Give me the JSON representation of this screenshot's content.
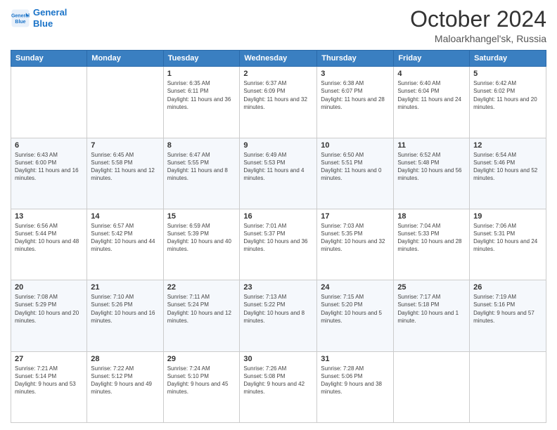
{
  "logo": {
    "line1": "General",
    "line2": "Blue"
  },
  "header": {
    "month": "October 2024",
    "location": "Maloarkhangel'sk, Russia"
  },
  "days_of_week": [
    "Sunday",
    "Monday",
    "Tuesday",
    "Wednesday",
    "Thursday",
    "Friday",
    "Saturday"
  ],
  "weeks": [
    [
      {
        "day": "",
        "sunrise": "",
        "sunset": "",
        "daylight": ""
      },
      {
        "day": "",
        "sunrise": "",
        "sunset": "",
        "daylight": ""
      },
      {
        "day": "1",
        "sunrise": "Sunrise: 6:35 AM",
        "sunset": "Sunset: 6:11 PM",
        "daylight": "Daylight: 11 hours and 36 minutes."
      },
      {
        "day": "2",
        "sunrise": "Sunrise: 6:37 AM",
        "sunset": "Sunset: 6:09 PM",
        "daylight": "Daylight: 11 hours and 32 minutes."
      },
      {
        "day": "3",
        "sunrise": "Sunrise: 6:38 AM",
        "sunset": "Sunset: 6:07 PM",
        "daylight": "Daylight: 11 hours and 28 minutes."
      },
      {
        "day": "4",
        "sunrise": "Sunrise: 6:40 AM",
        "sunset": "Sunset: 6:04 PM",
        "daylight": "Daylight: 11 hours and 24 minutes."
      },
      {
        "day": "5",
        "sunrise": "Sunrise: 6:42 AM",
        "sunset": "Sunset: 6:02 PM",
        "daylight": "Daylight: 11 hours and 20 minutes."
      }
    ],
    [
      {
        "day": "6",
        "sunrise": "Sunrise: 6:43 AM",
        "sunset": "Sunset: 6:00 PM",
        "daylight": "Daylight: 11 hours and 16 minutes."
      },
      {
        "day": "7",
        "sunrise": "Sunrise: 6:45 AM",
        "sunset": "Sunset: 5:58 PM",
        "daylight": "Daylight: 11 hours and 12 minutes."
      },
      {
        "day": "8",
        "sunrise": "Sunrise: 6:47 AM",
        "sunset": "Sunset: 5:55 PM",
        "daylight": "Daylight: 11 hours and 8 minutes."
      },
      {
        "day": "9",
        "sunrise": "Sunrise: 6:49 AM",
        "sunset": "Sunset: 5:53 PM",
        "daylight": "Daylight: 11 hours and 4 minutes."
      },
      {
        "day": "10",
        "sunrise": "Sunrise: 6:50 AM",
        "sunset": "Sunset: 5:51 PM",
        "daylight": "Daylight: 11 hours and 0 minutes."
      },
      {
        "day": "11",
        "sunrise": "Sunrise: 6:52 AM",
        "sunset": "Sunset: 5:48 PM",
        "daylight": "Daylight: 10 hours and 56 minutes."
      },
      {
        "day": "12",
        "sunrise": "Sunrise: 6:54 AM",
        "sunset": "Sunset: 5:46 PM",
        "daylight": "Daylight: 10 hours and 52 minutes."
      }
    ],
    [
      {
        "day": "13",
        "sunrise": "Sunrise: 6:56 AM",
        "sunset": "Sunset: 5:44 PM",
        "daylight": "Daylight: 10 hours and 48 minutes."
      },
      {
        "day": "14",
        "sunrise": "Sunrise: 6:57 AM",
        "sunset": "Sunset: 5:42 PM",
        "daylight": "Daylight: 10 hours and 44 minutes."
      },
      {
        "day": "15",
        "sunrise": "Sunrise: 6:59 AM",
        "sunset": "Sunset: 5:39 PM",
        "daylight": "Daylight: 10 hours and 40 minutes."
      },
      {
        "day": "16",
        "sunrise": "Sunrise: 7:01 AM",
        "sunset": "Sunset: 5:37 PM",
        "daylight": "Daylight: 10 hours and 36 minutes."
      },
      {
        "day": "17",
        "sunrise": "Sunrise: 7:03 AM",
        "sunset": "Sunset: 5:35 PM",
        "daylight": "Daylight: 10 hours and 32 minutes."
      },
      {
        "day": "18",
        "sunrise": "Sunrise: 7:04 AM",
        "sunset": "Sunset: 5:33 PM",
        "daylight": "Daylight: 10 hours and 28 minutes."
      },
      {
        "day": "19",
        "sunrise": "Sunrise: 7:06 AM",
        "sunset": "Sunset: 5:31 PM",
        "daylight": "Daylight: 10 hours and 24 minutes."
      }
    ],
    [
      {
        "day": "20",
        "sunrise": "Sunrise: 7:08 AM",
        "sunset": "Sunset: 5:29 PM",
        "daylight": "Daylight: 10 hours and 20 minutes."
      },
      {
        "day": "21",
        "sunrise": "Sunrise: 7:10 AM",
        "sunset": "Sunset: 5:26 PM",
        "daylight": "Daylight: 10 hours and 16 minutes."
      },
      {
        "day": "22",
        "sunrise": "Sunrise: 7:11 AM",
        "sunset": "Sunset: 5:24 PM",
        "daylight": "Daylight: 10 hours and 12 minutes."
      },
      {
        "day": "23",
        "sunrise": "Sunrise: 7:13 AM",
        "sunset": "Sunset: 5:22 PM",
        "daylight": "Daylight: 10 hours and 8 minutes."
      },
      {
        "day": "24",
        "sunrise": "Sunrise: 7:15 AM",
        "sunset": "Sunset: 5:20 PM",
        "daylight": "Daylight: 10 hours and 5 minutes."
      },
      {
        "day": "25",
        "sunrise": "Sunrise: 7:17 AM",
        "sunset": "Sunset: 5:18 PM",
        "daylight": "Daylight: 10 hours and 1 minute."
      },
      {
        "day": "26",
        "sunrise": "Sunrise: 7:19 AM",
        "sunset": "Sunset: 5:16 PM",
        "daylight": "Daylight: 9 hours and 57 minutes."
      }
    ],
    [
      {
        "day": "27",
        "sunrise": "Sunrise: 7:21 AM",
        "sunset": "Sunset: 5:14 PM",
        "daylight": "Daylight: 9 hours and 53 minutes."
      },
      {
        "day": "28",
        "sunrise": "Sunrise: 7:22 AM",
        "sunset": "Sunset: 5:12 PM",
        "daylight": "Daylight: 9 hours and 49 minutes."
      },
      {
        "day": "29",
        "sunrise": "Sunrise: 7:24 AM",
        "sunset": "Sunset: 5:10 PM",
        "daylight": "Daylight: 9 hours and 45 minutes."
      },
      {
        "day": "30",
        "sunrise": "Sunrise: 7:26 AM",
        "sunset": "Sunset: 5:08 PM",
        "daylight": "Daylight: 9 hours and 42 minutes."
      },
      {
        "day": "31",
        "sunrise": "Sunrise: 7:28 AM",
        "sunset": "Sunset: 5:06 PM",
        "daylight": "Daylight: 9 hours and 38 minutes."
      },
      {
        "day": "",
        "sunrise": "",
        "sunset": "",
        "daylight": ""
      },
      {
        "day": "",
        "sunrise": "",
        "sunset": "",
        "daylight": ""
      }
    ]
  ]
}
